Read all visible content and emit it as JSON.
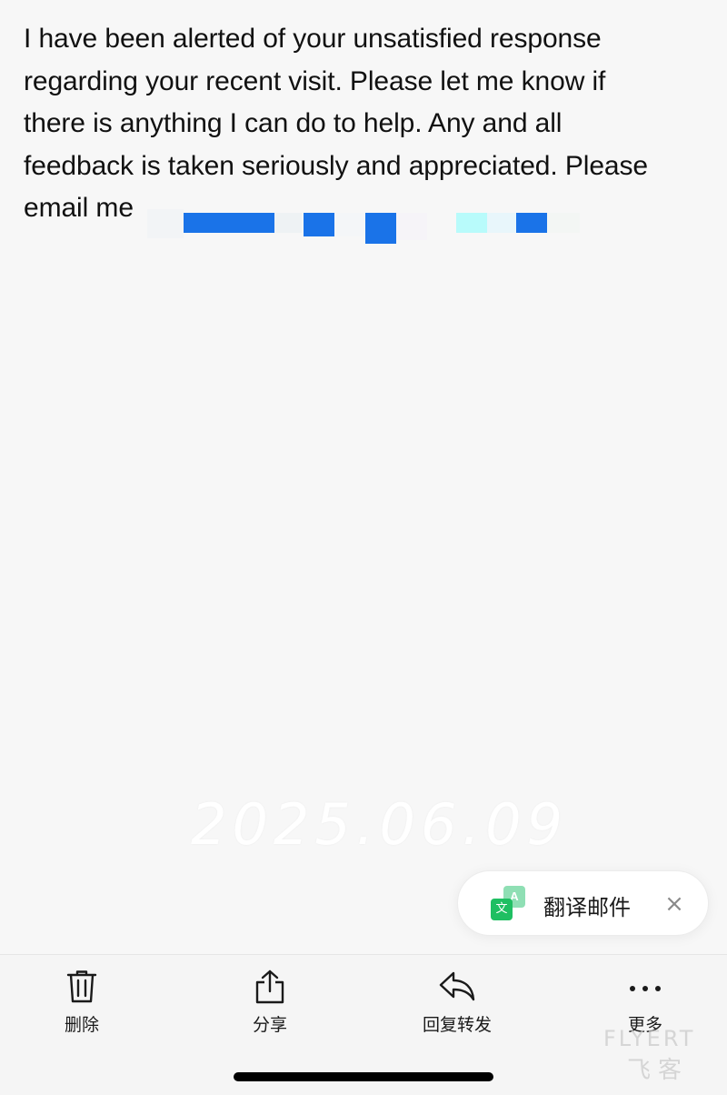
{
  "email": {
    "body_lines": [
      "I have been alerted of your unsatisfied response",
      "regarding your recent visit. Please let me know if",
      "there is anything I can do to help. Any and all",
      "feedback is taken seriously and appreciated. Please",
      "email me"
    ]
  },
  "watermark": {
    "date": "2025.06.09",
    "logo_line1": "FLYERT",
    "logo_line2": "飞客"
  },
  "translate": {
    "label": "翻译邮件",
    "icon_back_glyph": "A",
    "icon_front_glyph": "文",
    "close_glyph": "×",
    "accent_color": "#1fbf62"
  },
  "toolbar": {
    "delete_label": "删除",
    "share_label": "分享",
    "reply_forward_label": "回复转发",
    "more_label": "更多"
  },
  "colors": {
    "redaction_blue": "#1a73e8",
    "redaction_cyan": "#b8fbfb"
  }
}
